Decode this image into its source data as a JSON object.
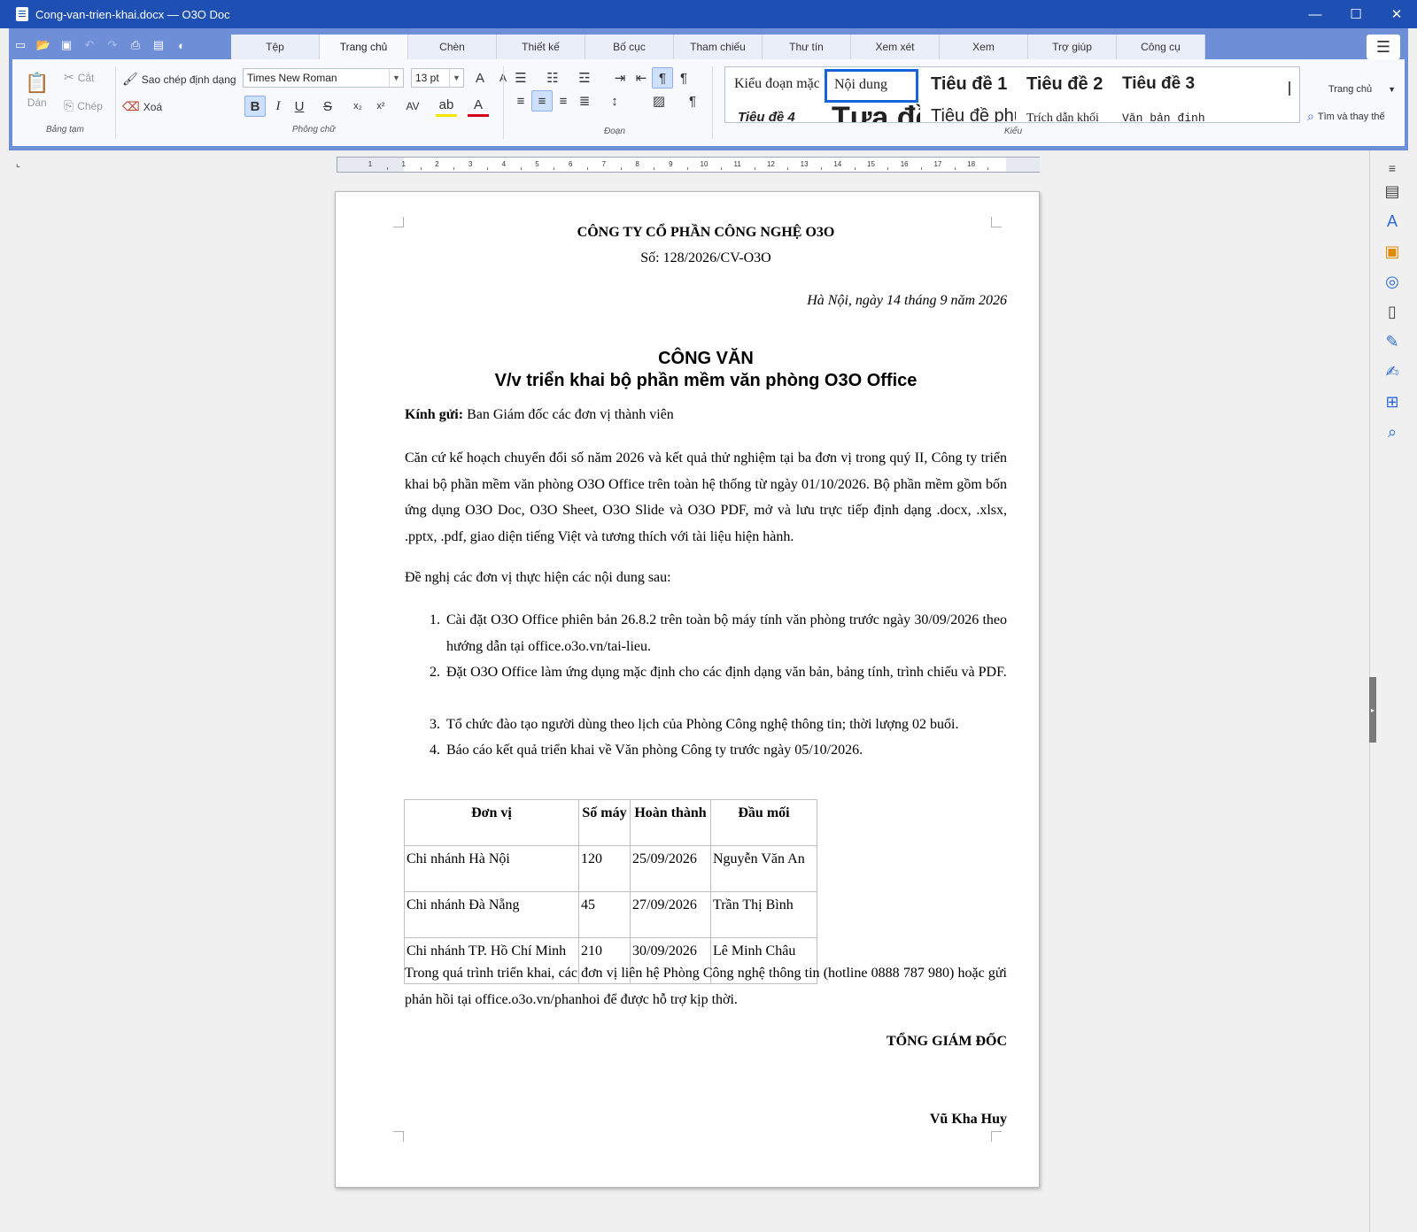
{
  "window": {
    "title": "Cong-van-trien-khai.docx — O3O Doc",
    "minimize": "—",
    "maximize": "☐",
    "close": "✕"
  },
  "ribbon_tabs": [
    "Tệp",
    "Trang chủ",
    "Chèn",
    "Thiết kế",
    "Bố cục",
    "Tham chiếu",
    "Thư tín",
    "Xem xét",
    "Xem",
    "Trợ giúp",
    "Công cụ"
  ],
  "active_tab": "Trang chủ",
  "clipboard": {
    "paste": "Dán",
    "cut": "Cắt",
    "copy": "Chép",
    "group": "Bảng tạm"
  },
  "font": {
    "format_painter": "Sao chép định dạng",
    "clear": "Xoá",
    "name": "Times New Roman",
    "size": "13 pt",
    "group": "Phông chữ"
  },
  "paragraph": {
    "group": "Đoạn"
  },
  "styles": {
    "items": [
      "Kiểu đoạn mặc định",
      "Nội dung",
      "Tiêu đề 1",
      "Tiêu đề 2",
      "Tiêu đề 3",
      "Tiêu đề 4",
      "Tựa đề",
      "Tiêu đề phụ",
      "Trích dẫn khối",
      "Văn bản định dạng sẵn"
    ],
    "group": "Kiểu"
  },
  "right_tools": {
    "select": "Trang chủ",
    "find_replace": "Tìm và thay thế"
  },
  "ruler": {
    "numbers": [
      "1",
      "1",
      "2",
      "3",
      "4",
      "5",
      "6",
      "7",
      "8",
      "9",
      "10",
      "11",
      "12",
      "13",
      "14",
      "15",
      "16",
      "17",
      "18"
    ]
  },
  "document": {
    "company": "CÔNG TY CỔ PHẦN CÔNG NGHỆ O3O",
    "number": "Số: 128/2026/CV-O3O",
    "date": "Hà Nội, ngày 14 tháng 9 năm 2026",
    "title1": "CÔNG VĂN",
    "title2": "V/v triển khai bộ phần mềm văn phòng O3O Office",
    "to_label": "Kính gửi:",
    "to_value": " Ban Giám đốc các đơn vị thành viên",
    "para1": "Căn cứ kế hoạch chuyển đổi số năm 2026 và kết quả thử nghiệm tại ba đơn vị trong quý II, Công ty triển khai bộ phần mềm văn phòng O3O Office trên toàn hệ thống từ ngày 01/10/2026. Bộ phần mềm gồm bốn ứng dụng O3O Doc, O3O Sheet, O3O Slide và O3O PDF, mở và lưu trực tiếp định dạng .docx, .xlsx, .pptx, .pdf, giao diện tiếng Việt và tương thích với tài liệu hiện hành.",
    "para2": "Đề nghị các đơn vị thực hiện các nội dung sau:",
    "list": [
      {
        "n": "1.",
        "t": "Cài đặt O3O Office phiên bản 26.8.2 trên toàn bộ máy tính văn phòng trước ngày 30/09/2026 theo hướng dẫn tại office.o3o.vn/tai-lieu."
      },
      {
        "n": "2.",
        "t": "Đặt O3O Office làm ứng dụng mặc định cho các định dạng văn bản, bảng tính, trình chiếu và PDF."
      },
      {
        "n": "3.",
        "t": "Tổ chức đào tạo người dùng theo lịch của Phòng Công nghệ thông tin; thời lượng 02 buổi."
      },
      {
        "n": "4.",
        "t": "Báo cáo kết quả triển khai về Văn phòng Công ty trước ngày 05/10/2026."
      }
    ],
    "table": {
      "headers": [
        "Đơn vị",
        "Số máy",
        "Hoàn thành",
        "Đầu mối"
      ],
      "rows": [
        [
          "Chi nhánh Hà Nội",
          "120",
          "25/09/2026",
          "Nguyễn Văn An"
        ],
        [
          "Chi nhánh Đà Nẵng",
          "45",
          "27/09/2026",
          "Trần Thị Bình"
        ],
        [
          "Chi nhánh TP. Hồ Chí Minh",
          "210",
          "30/09/2026",
          "Lê Minh Châu"
        ]
      ]
    },
    "para3": "Trong quá trình triển khai, các đơn vị liên hệ Phòng Công nghệ thông tin (hotline 0888 787 980) hoặc gửi phản hồi tại office.o3o.vn/phanhoi để được hỗ trợ kịp thời.",
    "signature_title": "TỔNG GIÁM ĐỐC",
    "signer": "Vũ Kha Huy"
  }
}
